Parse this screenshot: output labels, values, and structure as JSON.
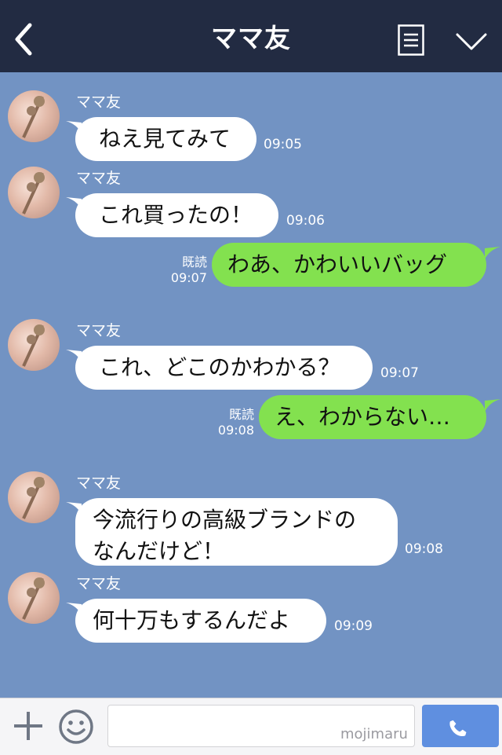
{
  "header": {
    "title": "ママ友",
    "back_icon": "chevron-left-icon",
    "menu_icon": "note-menu-icon",
    "expand_icon": "chevron-down-icon"
  },
  "messages": [
    {
      "from": "ママ友",
      "text": "ねえ見てみて",
      "time": "09:05"
    },
    {
      "from": "ママ友",
      "text": "これ買ったの！",
      "time": "09:06"
    },
    {
      "from": "me",
      "text": "わあ、かわいいバッグ",
      "read": "既読",
      "time": "09:07"
    },
    {
      "from": "ママ友",
      "text": "これ、どこのかわかる？",
      "time": "09:07"
    },
    {
      "from": "me",
      "text": "え、わからない…",
      "read": "既読",
      "time": "09:08"
    },
    {
      "from": "ママ友",
      "text_line1": "今流行りの高級ブランドの",
      "text_line2": "なんだけど！",
      "time": "09:08"
    },
    {
      "from": "ママ友",
      "text": "何十万もするんだよ",
      "time": "09:09"
    }
  ],
  "input": {
    "value": "",
    "watermark": "mojimaru",
    "plus_icon": "plus-icon",
    "emoji_icon": "smile-icon",
    "send_icon": "phone-icon"
  },
  "colors": {
    "header_bg": "#222b42",
    "chat_bg": "#7293c3",
    "my_bubble": "#83e14f",
    "their_bubble": "#ffffff",
    "send_button": "#5f8fe0"
  }
}
